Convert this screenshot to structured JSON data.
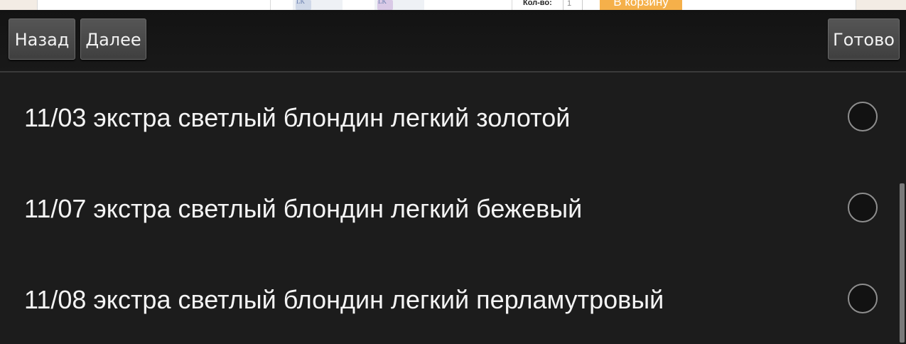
{
  "background_page": {
    "qty_label": "Кол-во:",
    "qty_value": "1",
    "cart_button": "В корзину",
    "bottle_text": "LK"
  },
  "toolbar": {
    "back_label": "Назад",
    "next_label": "Далее",
    "done_label": "Готово"
  },
  "options": [
    {
      "label": "11/03 экстра светлый блондин легкий золотой",
      "selected": false
    },
    {
      "label": "11/07 экстра светлый блондин легкий бежевый",
      "selected": false
    },
    {
      "label": "11/08 экстра светлый блондин легкий перламутровый",
      "selected": false
    }
  ],
  "colors": {
    "dialog_bg": "#1c1c1c",
    "toolbar_bg": "#161616",
    "button_bg": "#4a4a4a",
    "cart_accent": "#f5b04a"
  }
}
